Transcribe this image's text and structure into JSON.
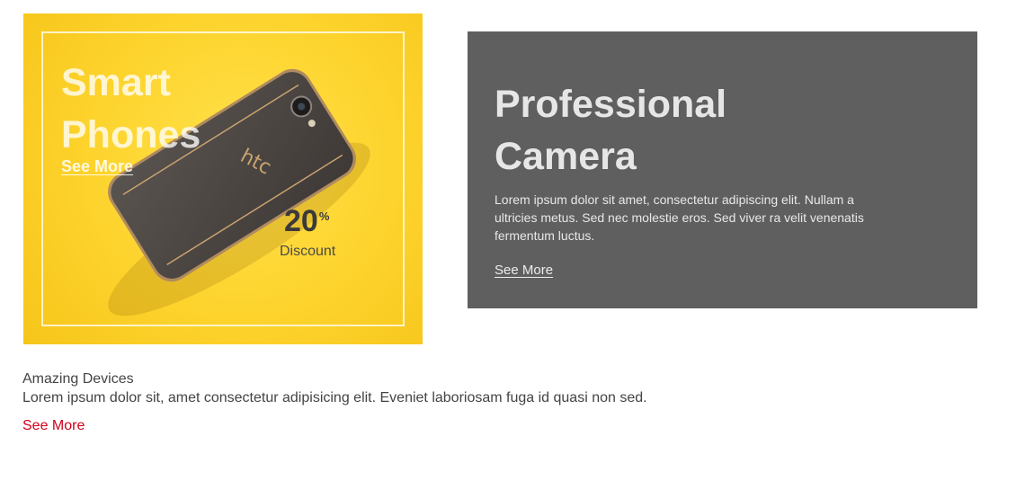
{
  "promo_phones": {
    "title": "Smart Phones",
    "link_label": "See More",
    "discount_value": "20",
    "discount_unit": "%",
    "discount_label": "Discount",
    "phone_brand": "htc",
    "background_color": "#fdd32c"
  },
  "promo_camera": {
    "title": "Professional Camera",
    "description": "Lorem ipsum dolor sit amet, consectetur adipiscing elit. Nullam a ultricies metus. Sed nec molestie eros. Sed viver ra velit venenatis fermentum luctus.",
    "link_label": "See More",
    "background_color": "#5f5f5f"
  },
  "amazing": {
    "heading": "Amazing Devices",
    "description": "Lorem ipsum dolor sit, amet consectetur adipisicing elit. Eveniet laboriosam fuga id quasi non sed.",
    "link_label": "See More",
    "link_color": "#d0021b"
  }
}
